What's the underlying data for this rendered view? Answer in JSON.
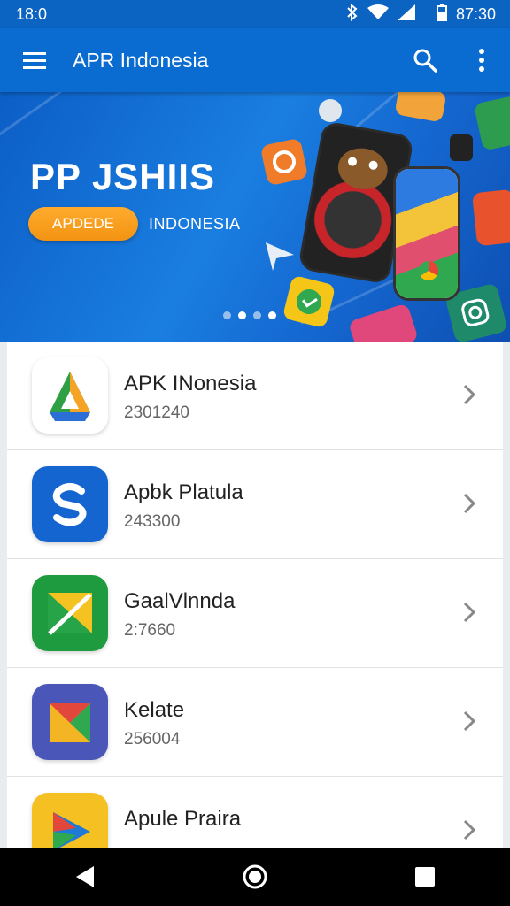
{
  "status_bar": {
    "time_left": "18:0",
    "time_right": "87:30",
    "icons": [
      "bluetooth-icon",
      "wifi-icon",
      "signal-icon",
      "battery-icon"
    ]
  },
  "app_bar": {
    "title": "APR Indonesia",
    "icons": [
      "menu-icon",
      "search-icon",
      "more-vert-icon"
    ]
  },
  "banner": {
    "headline": "PP JSHIIS",
    "button_label": "APDEDE",
    "subtitle": "INDONESIA",
    "carousel_dots": 4,
    "active_dot": 2
  },
  "apps": [
    {
      "name": "APK INonesia",
      "meta": "2301240",
      "icon": "triangle-logo-icon"
    },
    {
      "name": "Apbk Platula",
      "meta": "243300",
      "icon": "s-logo-icon"
    },
    {
      "name": "GaalVlnnda",
      "meta": "2:7660",
      "icon": "pen-logo-icon"
    },
    {
      "name": "Kelate",
      "meta": "256004",
      "icon": "layers-logo-icon"
    },
    {
      "name": "Apule Praira",
      "meta": "",
      "icon": "play-logo-icon"
    }
  ],
  "nav_bar": {
    "icons": [
      "back-icon",
      "home-icon",
      "recents-icon"
    ]
  },
  "colors": {
    "status_bar": "#0b63c2",
    "app_bar": "#0a6bd0",
    "banner_button": "#f39312",
    "nav_bar": "#000000"
  }
}
